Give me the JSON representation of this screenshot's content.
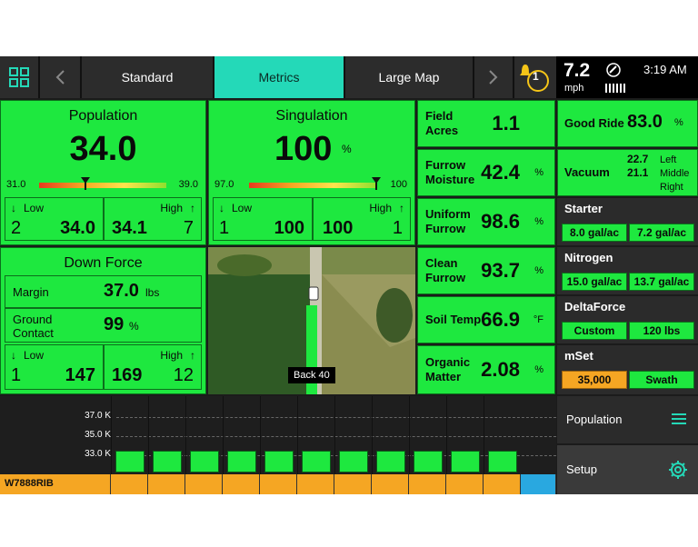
{
  "nav": {
    "tabs": [
      {
        "label": "Standard",
        "active": false
      },
      {
        "label": "Metrics",
        "active": true
      },
      {
        "label": "Large Map",
        "active": false
      }
    ],
    "alert_count": "1"
  },
  "status": {
    "speed": "7.2",
    "speed_unit": "mph",
    "time": "3:19 AM"
  },
  "population": {
    "title": "Population",
    "value": "34.0",
    "range_min": "31.0",
    "range_max": "39.0",
    "low_label": "Low",
    "low_count": "2",
    "low_value": "34.0",
    "high_label": "High",
    "high_value": "34.1",
    "high_count": "7"
  },
  "singulation": {
    "title": "Singulation",
    "value": "100",
    "unit": "%",
    "range_min": "97.0",
    "range_max": "100",
    "low_label": "Low",
    "low_count": "1",
    "low_value": "100",
    "high_label": "High",
    "high_value": "100",
    "high_count": "1"
  },
  "downforce": {
    "title": "Down Force",
    "margin_label": "Margin",
    "margin_value": "37.0",
    "margin_unit": "lbs",
    "ground_label": "Ground Contact",
    "ground_value": "99",
    "ground_unit": "%",
    "low_label": "Low",
    "low_count": "1",
    "low_value": "147",
    "high_label": "High",
    "high_value": "169",
    "high_count": "12"
  },
  "map": {
    "label": "Back 40"
  },
  "metrics": [
    {
      "label": "Field Acres",
      "value": "1.1",
      "unit": ""
    },
    {
      "label": "Furrow Moisture",
      "value": "42.4",
      "unit": "%"
    },
    {
      "label": "Uniform Furrow",
      "value": "98.6",
      "unit": "%"
    },
    {
      "label": "Clean Furrow",
      "value": "93.7",
      "unit": "%"
    },
    {
      "label": "Soil Temp",
      "value": "66.9",
      "unit": "°F"
    },
    {
      "label": "Organic Matter",
      "value": "2.08",
      "unit": "%"
    }
  ],
  "right": {
    "good_ride_label": "Good Ride",
    "good_ride_value": "83.0",
    "good_ride_unit": "%",
    "vacuum_label": "Vacuum",
    "vacuum_left": "22.7",
    "vacuum_middle": "21.1",
    "vacuum_left_label": "Left",
    "vacuum_middle_label": "Middle",
    "vacuum_right_label": "Right",
    "starter_title": "Starter",
    "starter_a": "8.0 gal/ac",
    "starter_b": "7.2 gal/ac",
    "nitrogen_title": "Nitrogen",
    "nitrogen_a": "15.0 gal/ac",
    "nitrogen_b": "13.7 gal/ac",
    "deltaforce_title": "DeltaForce",
    "deltaforce_a": "Custom",
    "deltaforce_b": "120 lbs",
    "mset_title": "mSet",
    "mset_a": "35,000",
    "mset_b": "Swath",
    "population_btn": "Population",
    "setup_btn": "Setup"
  },
  "row_chart": {
    "row_id": "W7888RIB",
    "ticks": [
      "37.0 K",
      "35.0 K",
      "33.0 K"
    ],
    "values": [
      33.5,
      33.5,
      33.5,
      33.5,
      33.5,
      33.5,
      33.5,
      33.5,
      33.5,
      33.5,
      33.5
    ],
    "colors": {
      "bar": "#1ee83f",
      "row": "#f5a623",
      "selected": "#29a8e0"
    }
  },
  "colors": {
    "tile": "#1ee83f",
    "accent": "#24d9b8",
    "bell": "#f5c518"
  }
}
